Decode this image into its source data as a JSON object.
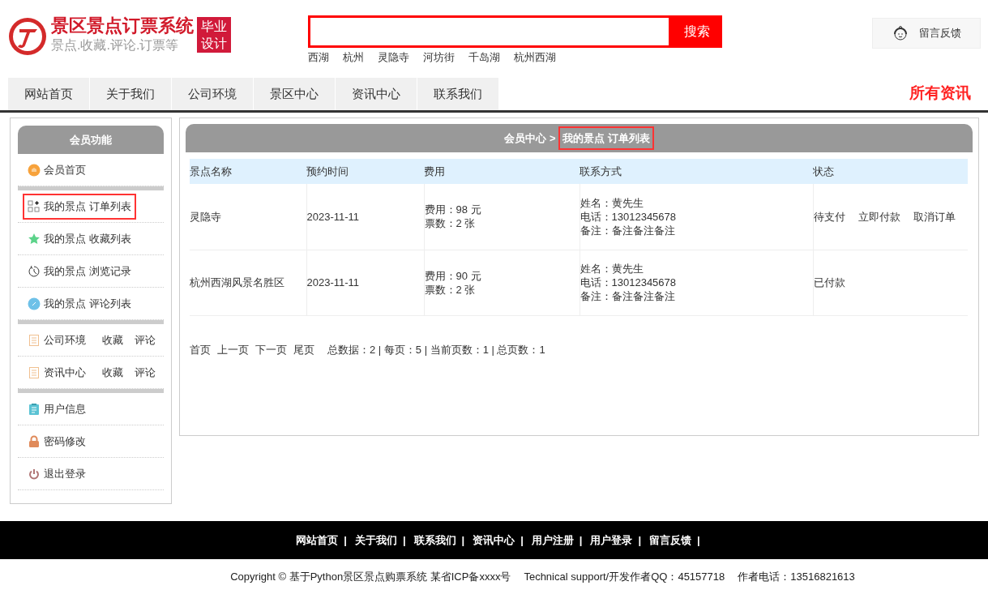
{
  "header": {
    "title": "景区景点订票系统",
    "subtitle": "景点.收藏.评论.订票等",
    "badge": [
      "毕业",
      "设计"
    ],
    "search": {
      "button": "搜索"
    },
    "hot_words": [
      "西湖",
      "杭州",
      "灵隐寺",
      "河坊街",
      "千岛湖",
      "杭州西湖"
    ],
    "feedback": "留言反馈"
  },
  "nav": {
    "items": [
      "网站首页",
      "关于我们",
      "公司环境",
      "景区中心",
      "资讯中心",
      "联系我们"
    ],
    "right_link": "所有资讯"
  },
  "sidebar": {
    "title": "会员功能",
    "groups": [
      [
        {
          "label": "会员首页",
          "selected": false
        }
      ],
      [
        {
          "label": "我的景点 订单列表",
          "selected": true
        },
        {
          "label": "我的景点 收藏列表",
          "selected": false
        },
        {
          "label": "我的景点 浏览记录",
          "selected": false
        },
        {
          "label": "我的景点 评论列表",
          "selected": false
        }
      ],
      [
        {
          "label": "公司环境",
          "links": [
            "收藏",
            "评论"
          ],
          "selected": false
        },
        {
          "label": "资讯中心",
          "links": [
            "收藏",
            "评论"
          ],
          "selected": false
        }
      ],
      [
        {
          "label": "用户信息",
          "selected": false
        },
        {
          "label": "密码修改",
          "selected": false
        },
        {
          "label": "退出登录",
          "selected": false
        }
      ]
    ]
  },
  "breadcrumb": {
    "parent": "会员中心",
    "separator": ">",
    "current": "我的景点 订单列表",
    "current_highlighted": true
  },
  "table": {
    "columns": [
      "景点名称",
      "预约时间",
      "费用",
      "联系方式",
      "状态"
    ],
    "rows": [
      {
        "name": "灵隐寺",
        "date": "2023-11-11",
        "fee": [
          "费用：98 元",
          "票数：2 张"
        ],
        "contact": [
          "姓名：黄先生",
          "电话：13012345678",
          "备注：备注备注备注"
        ],
        "status": "待支付",
        "actions": [
          "立即付款",
          "取消订单"
        ]
      },
      {
        "name": "杭州西湖风景名胜区",
        "date": "2023-11-11",
        "fee": [
          "费用：90 元",
          "票数：2 张"
        ],
        "contact": [
          "姓名：黄先生",
          "电话：13012345678",
          "备注：备注备注备注"
        ],
        "status": "已付款",
        "actions": []
      }
    ]
  },
  "pagination": {
    "links": [
      "首页",
      "上一页",
      "下一页",
      "尾页"
    ],
    "summary": "总数据：2 | 每页：5 | 当前页数：1 | 总页数：1"
  },
  "footer": {
    "links": [
      "网站首页",
      "关于我们",
      "联系我们",
      "资讯中心",
      "用户注册",
      "用户登录",
      "留言反馈"
    ],
    "separator": "|",
    "copyright": "Copyright © 基于Python景区景点购票系统 某省ICP备xxxx号",
    "support": "Technical support/开发作者QQ：45157718",
    "phone": "作者电话：13516821613"
  }
}
